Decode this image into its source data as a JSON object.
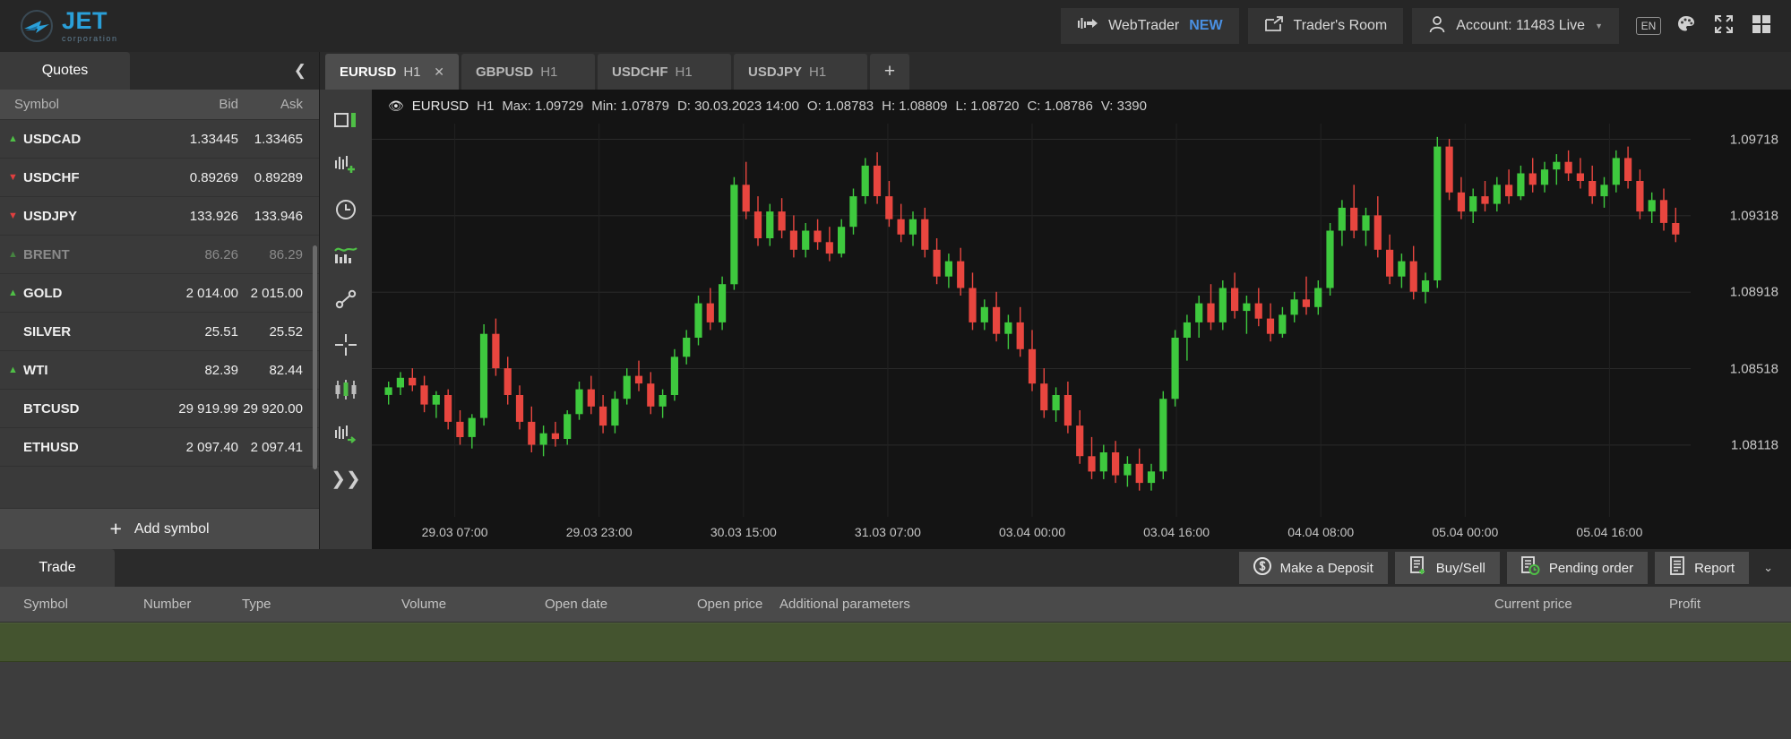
{
  "brand": {
    "name": "JET",
    "tagline": "corporation",
    "accent": "#2a9fd8"
  },
  "topbar": {
    "webtrader_label": "WebTrader",
    "webtrader_badge": "NEW",
    "traders_room_label": "Trader's Room",
    "account_label": "Account: 11483 Live",
    "language": "EN",
    "icons": [
      "webtrader-icon",
      "share-icon",
      "user-icon",
      "palette-icon",
      "fullscreen-icon",
      "layout-grid-icon"
    ]
  },
  "sidebar": {
    "tab_label": "Quotes",
    "collapse_icon": "chevron-left-icon",
    "columns": {
      "symbol": "Symbol",
      "bid": "Bid",
      "ask": "Ask"
    },
    "add_symbol_label": "Add symbol",
    "rows": [
      {
        "symbol": "USDCAD",
        "bid": "1.33445",
        "ask": "1.33465",
        "dir": "up",
        "dim": false
      },
      {
        "symbol": "USDCHF",
        "bid": "0.89269",
        "ask": "0.89289",
        "dir": "down",
        "dim": false
      },
      {
        "symbol": "USDJPY",
        "bid": "133.926",
        "ask": "133.946",
        "dir": "down",
        "dim": false
      },
      {
        "symbol": "BRENT",
        "bid": "86.26",
        "ask": "86.29",
        "dir": "up",
        "dim": true
      },
      {
        "symbol": "GOLD",
        "bid": "2 014.00",
        "ask": "2 015.00",
        "dir": "up",
        "dim": false
      },
      {
        "symbol": "SILVER",
        "bid": "25.51",
        "ask": "25.52",
        "dir": "none",
        "dim": false
      },
      {
        "symbol": "WTI",
        "bid": "82.39",
        "ask": "82.44",
        "dir": "up",
        "dim": false
      },
      {
        "symbol": "BTCUSD",
        "bid": "29 919.99",
        "ask": "29 920.00",
        "dir": "none",
        "dim": false
      },
      {
        "symbol": "ETHUSD",
        "bid": "2 097.40",
        "ask": "2 097.41",
        "dir": "none",
        "dim": false
      }
    ]
  },
  "chart_tabs": {
    "add_label": "+",
    "items": [
      {
        "symbol": "EURUSD",
        "timeframe": "H1",
        "active": true
      },
      {
        "symbol": "GBPUSD",
        "timeframe": "H1",
        "active": false
      },
      {
        "symbol": "USDCHF",
        "timeframe": "H1",
        "active": false
      },
      {
        "symbol": "USDJPY",
        "timeframe": "H1",
        "active": false
      }
    ]
  },
  "chart_tools": [
    {
      "name": "chart-type-icon"
    },
    {
      "name": "add-indicator-icon"
    },
    {
      "name": "timeframe-clock-icon"
    },
    {
      "name": "indicators-icon"
    },
    {
      "name": "line-tool-icon"
    },
    {
      "name": "crosshair-icon"
    },
    {
      "name": "candlestick-style-icon"
    },
    {
      "name": "chart-shift-icon"
    },
    {
      "name": "expand-more-icon"
    }
  ],
  "ohlc": {
    "eye_icon": "eye-icon",
    "symbol": "EURUSD",
    "timeframe": "H1",
    "max_label": "Max: 1.09729",
    "min_label": "Min: 1.07879",
    "date_label": "D: 30.03.2023 14:00",
    "open_label": "O: 1.08783",
    "high_label": "H: 1.08809",
    "low_label": "L: 1.08720",
    "close_label": "C: 1.08786",
    "volume_label": "V: 3390"
  },
  "chart_data": {
    "type": "candlestick",
    "title": "EURUSD H1",
    "xlabel": "",
    "ylabel": "",
    "ylim": [
      1.07879,
      1.09729
    ],
    "yticks": [
      "1.09718",
      "1.09318",
      "1.08918",
      "1.08518",
      "1.08118"
    ],
    "ytick_values": [
      1.09718,
      1.09318,
      1.08918,
      1.08518,
      1.08118
    ],
    "xticks": [
      "29.03 07:00",
      "29.03 23:00",
      "30.03 15:00",
      "31.03 07:00",
      "03.04 00:00",
      "03.04 16:00",
      "04.04 08:00",
      "05.04 00:00",
      "05.04 16:00"
    ],
    "grid": true,
    "up_color": "#3ec93e",
    "down_color": "#e8463f",
    "max": 1.09729,
    "min": 1.07879,
    "last_bar": {
      "open": 1.08783,
      "high": 1.08809,
      "low": 1.0872,
      "close": 1.08786,
      "volume": 3390,
      "date": "30.03.2023 14:00"
    },
    "ohlc": [
      [
        1.0838,
        1.0845,
        1.0833,
        1.0842
      ],
      [
        1.0842,
        1.085,
        1.0838,
        1.0847
      ],
      [
        1.0847,
        1.0852,
        1.084,
        1.0843
      ],
      [
        1.0843,
        1.0848,
        1.0829,
        1.0833
      ],
      [
        1.0833,
        1.084,
        1.0826,
        1.0838
      ],
      [
        1.0838,
        1.0841,
        1.082,
        1.0824
      ],
      [
        1.0824,
        1.083,
        1.0812,
        1.0816
      ],
      [
        1.0816,
        1.0828,
        1.081,
        1.0826
      ],
      [
        1.0826,
        1.0875,
        1.0822,
        1.087
      ],
      [
        1.087,
        1.0878,
        1.0848,
        1.0852
      ],
      [
        1.0852,
        1.0858,
        1.0833,
        1.0838
      ],
      [
        1.0838,
        1.0843,
        1.082,
        1.0824
      ],
      [
        1.0824,
        1.0832,
        1.0808,
        1.0812
      ],
      [
        1.0812,
        1.0822,
        1.0806,
        1.0818
      ],
      [
        1.0818,
        1.0824,
        1.0811,
        1.0815
      ],
      [
        1.0815,
        1.083,
        1.0812,
        1.0828
      ],
      [
        1.0828,
        1.0845,
        1.0825,
        1.0841
      ],
      [
        1.0841,
        1.0848,
        1.0828,
        1.0832
      ],
      [
        1.0832,
        1.0838,
        1.0818,
        1.0822
      ],
      [
        1.0822,
        1.084,
        1.0818,
        1.0836
      ],
      [
        1.0836,
        1.0852,
        1.0833,
        1.0848
      ],
      [
        1.0848,
        1.0856,
        1.084,
        1.0844
      ],
      [
        1.0844,
        1.085,
        1.0828,
        1.0832
      ],
      [
        1.0832,
        1.0841,
        1.0826,
        1.0838
      ],
      [
        1.0838,
        1.0862,
        1.0835,
        1.0858
      ],
      [
        1.0858,
        1.0872,
        1.0854,
        1.0868
      ],
      [
        1.0868,
        1.089,
        1.0864,
        1.0886
      ],
      [
        1.0886,
        1.0894,
        1.0872,
        1.0876
      ],
      [
        1.0876,
        1.09,
        1.0872,
        1.0896
      ],
      [
        1.0896,
        1.0952,
        1.0893,
        1.0948
      ],
      [
        1.0948,
        1.096,
        1.093,
        1.0934
      ],
      [
        1.0934,
        1.0942,
        1.0916,
        1.092
      ],
      [
        1.092,
        1.0938,
        1.0916,
        1.0934
      ],
      [
        1.0934,
        1.0941,
        1.092,
        1.0924
      ],
      [
        1.0924,
        1.0932,
        1.091,
        1.0914
      ],
      [
        1.0914,
        1.0928,
        1.091,
        1.0924
      ],
      [
        1.0924,
        1.093,
        1.0914,
        1.0918
      ],
      [
        1.0918,
        1.0926,
        1.0908,
        1.0912
      ],
      [
        1.0912,
        1.093,
        1.091,
        1.0926
      ],
      [
        1.0926,
        1.0946,
        1.0922,
        1.0942
      ],
      [
        1.0942,
        1.0962,
        1.0938,
        1.0958
      ],
      [
        1.0958,
        1.0965,
        1.0938,
        1.0942
      ],
      [
        1.0942,
        1.095,
        1.0926,
        1.093
      ],
      [
        1.093,
        1.0938,
        1.0918,
        1.0922
      ],
      [
        1.0922,
        1.0934,
        1.0916,
        1.093
      ],
      [
        1.093,
        1.0936,
        1.091,
        1.0914
      ],
      [
        1.0914,
        1.092,
        1.0896,
        1.09
      ],
      [
        1.09,
        1.0912,
        1.0894,
        1.0908
      ],
      [
        1.0908,
        1.0915,
        1.089,
        1.0894
      ],
      [
        1.0894,
        1.0902,
        1.0872,
        1.0876
      ],
      [
        1.0876,
        1.0888,
        1.0872,
        1.0884
      ],
      [
        1.0884,
        1.0892,
        1.0866,
        1.087
      ],
      [
        1.087,
        1.088,
        1.0862,
        1.0876
      ],
      [
        1.0876,
        1.0884,
        1.0858,
        1.0862
      ],
      [
        1.0862,
        1.0872,
        1.084,
        1.0844
      ],
      [
        1.0844,
        1.0852,
        1.0826,
        1.083
      ],
      [
        1.083,
        1.0842,
        1.0824,
        1.0838
      ],
      [
        1.0838,
        1.0845,
        1.0818,
        1.0822
      ],
      [
        1.0822,
        1.083,
        1.0802,
        1.0806
      ],
      [
        1.0806,
        1.0816,
        1.0794,
        1.0798
      ],
      [
        1.0798,
        1.0812,
        1.0794,
        1.0808
      ],
      [
        1.0808,
        1.0814,
        1.0792,
        1.0796
      ],
      [
        1.0796,
        1.0806,
        1.079,
        1.0802
      ],
      [
        1.0802,
        1.081,
        1.0788,
        1.0792
      ],
      [
        1.0792,
        1.0802,
        1.0788,
        1.0798
      ],
      [
        1.0798,
        1.084,
        1.0794,
        1.0836
      ],
      [
        1.0836,
        1.0872,
        1.0832,
        1.0868
      ],
      [
        1.0868,
        1.088,
        1.0856,
        1.0876
      ],
      [
        1.0876,
        1.089,
        1.0868,
        1.0886
      ],
      [
        1.0886,
        1.0896,
        1.0872,
        1.0876
      ],
      [
        1.0876,
        1.0898,
        1.0872,
        1.0894
      ],
      [
        1.0894,
        1.0902,
        1.0878,
        1.0882
      ],
      [
        1.0882,
        1.089,
        1.087,
        1.0886
      ],
      [
        1.0886,
        1.0894,
        1.0874,
        1.0878
      ],
      [
        1.0878,
        1.0886,
        1.0866,
        1.087
      ],
      [
        1.087,
        1.0884,
        1.0868,
        1.088
      ],
      [
        1.088,
        1.0892,
        1.0876,
        1.0888
      ],
      [
        1.0888,
        1.09,
        1.088,
        1.0884
      ],
      [
        1.0884,
        1.0898,
        1.088,
        1.0894
      ],
      [
        1.0894,
        1.0928,
        1.089,
        1.0924
      ],
      [
        1.0924,
        1.094,
        1.0916,
        1.0936
      ],
      [
        1.0936,
        1.0948,
        1.092,
        1.0924
      ],
      [
        1.0924,
        1.0936,
        1.0916,
        1.0932
      ],
      [
        1.0932,
        1.0942,
        1.091,
        1.0914
      ],
      [
        1.0914,
        1.0922,
        1.0896,
        1.09
      ],
      [
        1.09,
        1.0912,
        1.0894,
        1.0908
      ],
      [
        1.0908,
        1.0916,
        1.0888,
        1.0892
      ],
      [
        1.0892,
        1.0902,
        1.0886,
        1.0898
      ],
      [
        1.0898,
        1.0973,
        1.0894,
        1.0968
      ],
      [
        1.0968,
        1.0972,
        1.094,
        1.0944
      ],
      [
        1.0944,
        1.0952,
        1.093,
        1.0934
      ],
      [
        1.0934,
        1.0946,
        1.0928,
        1.0942
      ],
      [
        1.0942,
        1.095,
        1.0934,
        1.0938
      ],
      [
        1.0938,
        1.0952,
        1.0934,
        1.0948
      ],
      [
        1.0948,
        1.0956,
        1.0938,
        1.0942
      ],
      [
        1.0942,
        1.0958,
        1.094,
        1.0954
      ],
      [
        1.0954,
        1.0962,
        1.0944,
        1.0948
      ],
      [
        1.0948,
        1.096,
        1.0944,
        1.0956
      ],
      [
        1.0956,
        1.0964,
        1.0948,
        1.096
      ],
      [
        1.096,
        1.0966,
        1.095,
        1.0954
      ],
      [
        1.0954,
        1.0962,
        1.0946,
        1.095
      ],
      [
        1.095,
        1.0958,
        1.0938,
        1.0942
      ],
      [
        1.0942,
        1.0952,
        1.0936,
        1.0948
      ],
      [
        1.0948,
        1.0966,
        1.0944,
        1.0962
      ],
      [
        1.0962,
        1.0968,
        1.0946,
        1.095
      ],
      [
        1.095,
        1.0956,
        1.093,
        1.0934
      ],
      [
        1.0934,
        1.0944,
        1.0928,
        1.094
      ],
      [
        1.094,
        1.0946,
        1.0924,
        1.0928
      ],
      [
        1.0928,
        1.0936,
        1.0918,
        1.0922
      ]
    ]
  },
  "bottom": {
    "tab_label": "Trade",
    "columns": [
      "Symbol",
      "Number",
      "Type",
      "Volume",
      "Open date",
      "Open price",
      "Additional parameters",
      "Current price",
      "Profit"
    ],
    "actions": [
      {
        "label": "Make a Deposit",
        "icon": "dollar-circle-icon"
      },
      {
        "label": "Buy/Sell",
        "icon": "document-plus-icon"
      },
      {
        "label": "Pending order",
        "icon": "document-clock-icon"
      },
      {
        "label": "Report",
        "icon": "document-lines-icon"
      }
    ],
    "collapse_icon": "chevron-down-icon"
  }
}
